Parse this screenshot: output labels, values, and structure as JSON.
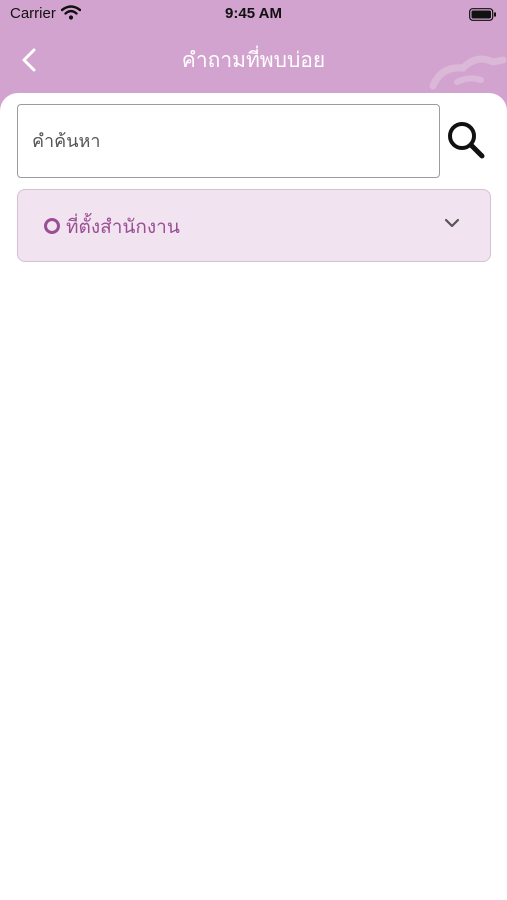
{
  "status_bar": {
    "carrier": "Carrier",
    "time": "9:45 AM"
  },
  "nav": {
    "title": "คำถามที่พบบ่อย",
    "back_icon": "chevron-left-icon"
  },
  "search": {
    "placeholder": "คำค้นหา",
    "value": "",
    "icon": "magnifier-icon"
  },
  "faq": {
    "items": [
      {
        "label": "ที่ตั้งสำนักงาน",
        "expanded": false
      }
    ]
  },
  "colors": {
    "header": "#d3a3cf",
    "accent": "#9a4f95",
    "item_bg": "#f1e3ef"
  }
}
